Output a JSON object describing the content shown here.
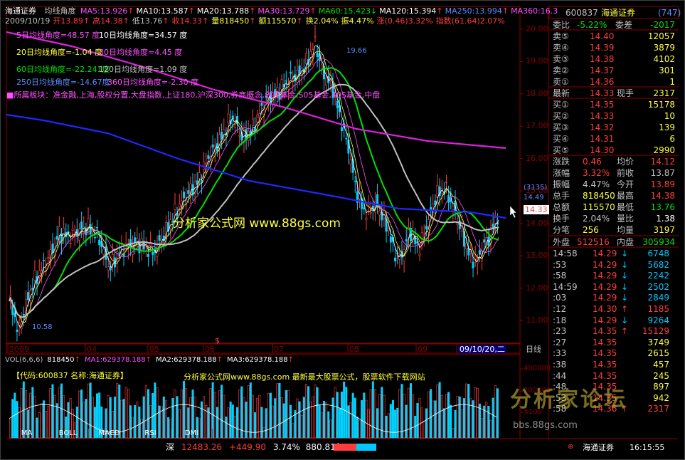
{
  "header": {
    "name": "海通证券",
    "indicator": "均线角度",
    "ma": [
      {
        "k": "MA5",
        "v": "13.926",
        "c": "#ff50ff",
        "a": "up"
      },
      {
        "k": "MA10",
        "v": "13.587",
        "c": "#ffffff",
        "a": "up"
      },
      {
        "k": "MA20",
        "v": "13.788",
        "c": "#ffffff",
        "a": "up"
      },
      {
        "k": "MA30",
        "v": "13.729",
        "c": "#ff50ff",
        "a": "up"
      },
      {
        "k": "MA60",
        "v": "15.423",
        "c": "#00e000",
        "a": "down"
      },
      {
        "k": "MA120",
        "v": "15.394",
        "c": "#ffffff",
        "a": "up"
      },
      {
        "k": "MA250",
        "v": "13.994",
        "c": "#5a8cff",
        "a": "up"
      },
      {
        "k": "MA360",
        "v": "16.3",
        "c": "#ff50ff",
        "a": ""
      }
    ],
    "line2": [
      {
        "t": "2009/10/19",
        "c": "#c0c0c0"
      },
      {
        "t": "开13.89",
        "c": "#ff3c3c",
        "a": "up"
      },
      {
        "t": "高14.38",
        "c": "#ff3c3c",
        "a": "up"
      },
      {
        "t": "低13.76",
        "c": "#c0c0c0",
        "a": "up"
      },
      {
        "t": "收14.33",
        "c": "#ff3c3c",
        "a": "up"
      },
      {
        "t": "量818450",
        "c": "#ffff3c",
        "a": "up"
      },
      {
        "t": "额115570",
        "c": "#ffff3c",
        "a": "up"
      },
      {
        "t": "换2.04%",
        "c": "#ffff3c"
      },
      {
        "t": "振4.47%",
        "c": "#ffff3c"
      },
      {
        "t": "涨(0.46)3.32%",
        "c": "#ff3c3c"
      },
      {
        "t": "指数(61.64)2.07%",
        "c": "#ff3c3c"
      }
    ]
  },
  "angles": [
    {
      "a": "5日均线角度=48.57 度",
      "b": "10日均线角度=34.57 度",
      "ca": "#ff50ff",
      "cb": "#ffffff"
    },
    {
      "a": "20日均线角度=-1.04 度",
      "b": "30日均线角度=4.45 度",
      "ca": "#ffff3c",
      "cb": "#ff50ff"
    },
    {
      "a": "60日均线角度=-22.241度",
      "b": "120日均线角度=1.09 度",
      "ca": "#00e000",
      "cb": "#c0c0c0"
    },
    {
      "a": "250日均线角度=-14.67度",
      "b": "360日均线角度=-2.30 度",
      "ca": "#5a8cff",
      "cb": "#ff50ff"
    }
  ],
  "sector": "■所属板块：准金融,上海,股权分置,大盘指数,上证180,沪深300,券商概念,创投基金,S05基金,40S基金,中盘",
  "watermark": "分析家公式网 www.88gs.com",
  "chart_data": {
    "type": "candlestick",
    "ylim": [
      10.3,
      20.7
    ],
    "yticks": [
      "20.00",
      "19.00",
      "18.00",
      "17.00",
      "16.00",
      "15.00",
      "14.00",
      "13.00",
      "12.00",
      "11.00"
    ],
    "xlabels": [
      "2009",
      "04",
      "05",
      "06",
      "07",
      "08",
      "09",
      "09/10/20,二"
    ],
    "period": "日线",
    "high_label": "19.66",
    "low_label": "10.58",
    "price_box": "(3135)",
    "price_box2": "14.49",
    "price_tag": "14.33",
    "dollar": "$"
  },
  "vol": {
    "header": [
      {
        "t": "VOL(6,6,6)",
        "c": "#c0c0c0"
      },
      {
        "t": "818450",
        "c": "#ffffff",
        "a": "up"
      },
      {
        "t": "MA1:629378.188",
        "c": "#ff50ff",
        "a": "up"
      },
      {
        "t": "MA2:629378.188",
        "c": "#ffffff",
        "a": "up"
      },
      {
        "t": "MA3:629378.188",
        "c": "#ffffff",
        "a": "up"
      }
    ],
    "info": "【代码:600837 名称:海通证券】",
    "info2": "分析家公式网www.88gs.com 最新最大股票公式，股票软件下载网站",
    "yticks": [
      "400000",
      "200000",
      "X100"
    ]
  },
  "tabs": [
    "MA",
    "BOLL",
    "MACD",
    "RSI",
    "DMI"
  ],
  "status": {
    "mkt": "深",
    "idx": "12483.26",
    "chg": "+449.90",
    "pct": "3.74%",
    "amt": "880.81亿",
    "broker": "海通证券",
    "time": "16:15:55"
  },
  "panel": {
    "code": "600837",
    "name": "海通证券",
    "tag": "(747)",
    "wb_l": "委比",
    "wb_v": "-5.22%",
    "wc_l": "委差",
    "wc_v": "-2017",
    "asks": [
      {
        "l": "卖⑤",
        "p": "14.40",
        "v": "12057"
      },
      {
        "l": "卖④",
        "p": "14.39",
        "v": "3879"
      },
      {
        "l": "卖③",
        "p": "14.38",
        "v": "4102"
      },
      {
        "l": "卖②",
        "p": "14.37",
        "v": "301"
      },
      {
        "l": "卖①",
        "p": "14.36",
        "v": "1"
      }
    ],
    "last_l": "最新",
    "last_p": "14.33",
    "xs_l": "现手",
    "xs_v": "2317",
    "bids": [
      {
        "l": "买①",
        "p": "14.35",
        "v": "15178"
      },
      {
        "l": "买②",
        "p": "14.33",
        "v": "10"
      },
      {
        "l": "买③",
        "p": "14.32",
        "v": "139"
      },
      {
        "l": "买④",
        "p": "14.31",
        "v": "6"
      },
      {
        "l": "买⑤",
        "p": "14.30",
        "v": "2990"
      }
    ],
    "stats": [
      {
        "l1": "涨跌",
        "v1": "0.46",
        "c1": "#ff3c3c",
        "l2": "均价",
        "v2": "14.12",
        "c2": "#ff3c3c"
      },
      {
        "l1": "涨幅",
        "v1": "3.32%",
        "c1": "#ff3c3c",
        "l2": "前收",
        "v2": "13.87",
        "c2": "#c0c0c0"
      },
      {
        "l1": "振幅",
        "v1": "4.47%",
        "c1": "#c0c0c0",
        "l2": "今开",
        "v2": "13.89",
        "c2": "#ff3c3c"
      },
      {
        "l1": "总手",
        "v1": "818450",
        "c1": "#ffff3c",
        "l2": "最高",
        "v2": "14.38",
        "c2": "#ff3c3c"
      },
      {
        "l1": "总额",
        "v1": "115570",
        "c1": "#ffff3c",
        "l2": "最低",
        "v2": "13.76",
        "c2": "#00e000"
      },
      {
        "l1": "换手",
        "v1": "2.04%",
        "c1": "#c0c0c0",
        "l2": "量比",
        "v2": "1.38",
        "c2": "#ffffff"
      },
      {
        "l1": "分笔",
        "v1": "256",
        "c1": "#ffff3c",
        "l2": "均量",
        "v2": "3197",
        "c2": "#ffff3c"
      }
    ],
    "wp_l": "外盘",
    "wp_v": "512516",
    "np_l": "内盘",
    "np_v": "305934",
    "ticks": [
      {
        "t": "14:58",
        "p": "14.29",
        "v": "6748",
        "a": "down"
      },
      {
        "t": ":53",
        "p": "14.29",
        "v": "5682",
        "a": "down"
      },
      {
        "t": ":58",
        "p": "14.29",
        "v": "2242",
        "a": "down"
      },
      {
        "t": "14:59",
        "p": "14.29",
        "v": "2502",
        "a": "down"
      },
      {
        "t": ":03",
        "p": "14.29",
        "v": "2849",
        "a": "down"
      },
      {
        "t": ":12",
        "p": "14.30",
        "v": "1185",
        "a": "up"
      },
      {
        "t": ":18",
        "p": "14.29",
        "v": "9264",
        "a": "down"
      },
      {
        "t": ":23",
        "p": "14.35",
        "v": "15129",
        "a": "up"
      },
      {
        "t": ":27",
        "p": "14.35",
        "v": "3749",
        "a": ""
      },
      {
        "t": ":33",
        "p": "14.35",
        "v": "2615",
        "a": ""
      },
      {
        "t": ":38",
        "p": "14.35",
        "v": "457",
        "a": ""
      },
      {
        "t": ":44",
        "p": "14.35",
        "v": "245",
        "a": ""
      },
      {
        "t": ":48",
        "p": "14.35",
        "v": "897",
        "a": ""
      },
      {
        "t": ":53",
        "p": "14.35",
        "v": "942",
        "a": ""
      },
      {
        "t": ":58",
        "p": "14.36",
        "v": "2317",
        "a": "up"
      }
    ],
    "brand_wm": "分析家论坛",
    "brand_url": "bbs.88gs.com"
  }
}
